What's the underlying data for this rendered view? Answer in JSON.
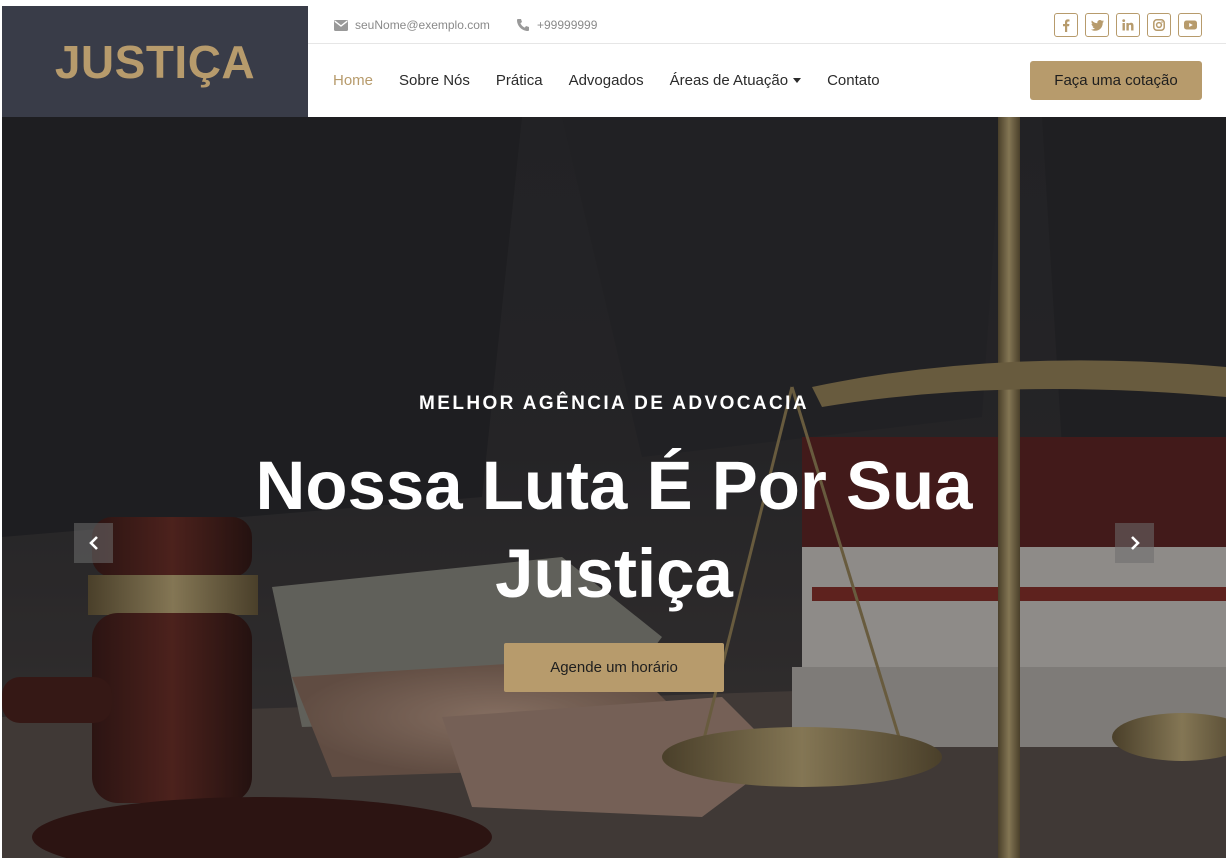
{
  "brand": {
    "logo_text": "JUSTIÇA"
  },
  "topbar": {
    "email": "seuNome@exemplo.com",
    "phone": "+99999999",
    "email_icon": "envelope-icon",
    "phone_icon": "phone-icon",
    "socials": [
      {
        "name": "facebook-icon",
        "glyph": "f"
      },
      {
        "name": "twitter-icon",
        "glyph": "t"
      },
      {
        "name": "linkedin-icon",
        "glyph": "in"
      },
      {
        "name": "instagram-icon",
        "glyph": "ig"
      },
      {
        "name": "youtube-icon",
        "glyph": "yt"
      }
    ]
  },
  "nav": {
    "items": [
      {
        "label": "Home",
        "active": true
      },
      {
        "label": "Sobre Nós"
      },
      {
        "label": "Prática"
      },
      {
        "label": "Advogados"
      },
      {
        "label": "Áreas de Atuação",
        "dropdown": true
      },
      {
        "label": "Contato"
      }
    ],
    "cta_label": "Faça uma cotação"
  },
  "hero": {
    "subtitle": "MELHOR AGÊNCIA DE ADVOCACIA",
    "title": "Nossa Luta É Por Sua Justiça",
    "button_label": "Agende um horário",
    "prev_icon": "chevron-left-icon",
    "next_icon": "chevron-right-icon"
  },
  "colors": {
    "accent": "#b79b6c",
    "logo_bg": "#393c48",
    "text_dark": "#2b2b2b"
  }
}
